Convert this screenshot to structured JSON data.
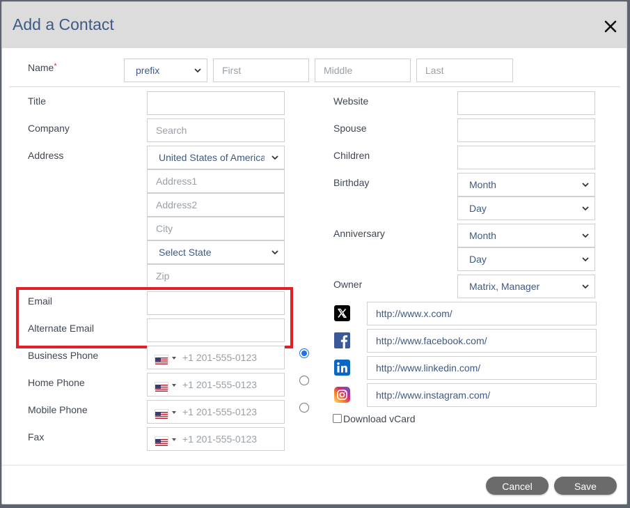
{
  "dialog": {
    "title": "Add a Contact"
  },
  "name_row": {
    "label": "Name",
    "required_mark": "*",
    "prefix_selected": "prefix",
    "first_placeholder": "First",
    "middle_placeholder": "Middle",
    "last_placeholder": "Last"
  },
  "left": {
    "title_label": "Title",
    "title_value": "",
    "company_label": "Company",
    "company_placeholder": "Search",
    "address_label": "Address",
    "country_selected": "United States of America",
    "address1_placeholder": "Address1",
    "address2_placeholder": "Address2",
    "city_placeholder": "City",
    "state_selected": "Select State",
    "zip_placeholder": "Zip",
    "email_label": "Email",
    "email_value": "",
    "alt_email_label": "Alternate Email",
    "alt_email_value": ""
  },
  "phones": [
    {
      "label": "Business Phone",
      "placeholder": "+1 201-555-0123",
      "primary": true
    },
    {
      "label": "Home Phone",
      "placeholder": "+1 201-555-0123",
      "primary": false
    },
    {
      "label": "Mobile Phone",
      "placeholder": "+1 201-555-0123",
      "primary": false
    },
    {
      "label": "Fax",
      "placeholder": "+1 201-555-0123"
    }
  ],
  "right": {
    "website_label": "Website",
    "website_value": "",
    "spouse_label": "Spouse",
    "spouse_value": "",
    "children_label": "Children",
    "children_value": "",
    "birthday_label": "Birthday",
    "birthday_month": "Month",
    "birthday_day": "Day",
    "anniversary_label": "Anniversary",
    "anniversary_month": "Month",
    "anniversary_day": "Day",
    "owner_label": "Owner",
    "owner_selected": "Matrix, Manager"
  },
  "social": [
    {
      "icon": "x-icon",
      "value": "http://www.x.com/",
      "color": "#000000"
    },
    {
      "icon": "facebook-icon",
      "value": "http://www.facebook.com/",
      "color": "#3b5998"
    },
    {
      "icon": "linkedin-icon",
      "value": "http://www.linkedin.com/",
      "color": "#0a66c2"
    },
    {
      "icon": "instagram-icon",
      "value": "http://www.instagram.com/",
      "color": "#d62976"
    }
  ],
  "vcard": {
    "label": "Download vCard",
    "checked": false
  },
  "footer": {
    "cancel_label": "Cancel",
    "save_label": "Save"
  },
  "colors": {
    "header_bg": "#dcdcdc",
    "title_color": "#3e5a84",
    "highlight_border": "#e01f26",
    "button_bg": "#6b6b6b"
  }
}
